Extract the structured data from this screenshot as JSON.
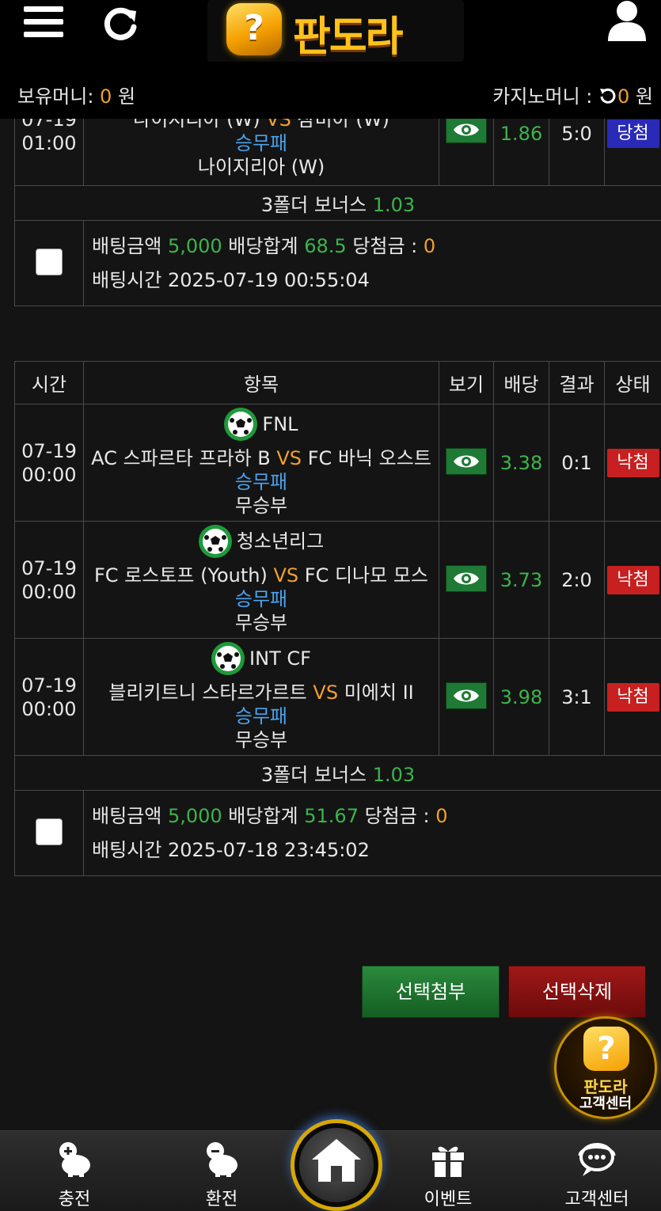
{
  "header": {
    "logo_text": "판도라",
    "logo_badge": "?",
    "money_label": "보유머니: ",
    "money_value": "0",
    "money_unit": " 원",
    "casino_label": "카지노머니 : ",
    "casino_value": "0",
    "casino_unit": " 원"
  },
  "table_headers": [
    "시간",
    "항목",
    "보기",
    "배당",
    "결과",
    "상태"
  ],
  "vs_text": "VS",
  "group1": {
    "row": {
      "time_line1": "07-19",
      "time_line2": "01:00",
      "match_home": "나이지리아 (W)",
      "match_away": "잠비아 (W)",
      "market": "승무패",
      "pick": "나이지리아 (W)",
      "odds": "1.86",
      "result": "5:0",
      "state": "당첨"
    },
    "bonus_label": "3폴더 보너스 ",
    "bonus_value": "1.03",
    "bet_amount_label": "배팅금액 ",
    "bet_amount": "5,000",
    "odds_total_label": " 배당합계 ",
    "odds_total": "68.5",
    "win_label": " 당첨금 : ",
    "win_amount": "0",
    "bet_time_label": "배팅시간 ",
    "bet_time": "2025-07-19 00:55:04"
  },
  "group2": {
    "rows": [
      {
        "time_line1": "07-19",
        "time_line2": "00:00",
        "league": "FNL",
        "match_home": "AC 스파르타 프라하 B",
        "match_away": "FC 바닉 오스트",
        "market": "승무패",
        "pick": "무승부",
        "odds": "3.38",
        "result": "0:1",
        "state": "낙첨"
      },
      {
        "time_line1": "07-19",
        "time_line2": "00:00",
        "league": "청소년리그",
        "match_home": "FC 로스토프 (Youth)",
        "match_away": "FC 디나모 모스",
        "market": "승무패",
        "pick": "무승부",
        "odds": "3.73",
        "result": "2:0",
        "state": "낙첨"
      },
      {
        "time_line1": "07-19",
        "time_line2": "00:00",
        "league": "INT CF",
        "match_home": "블리키트니 스타르가르트",
        "match_away": "미에치 II",
        "market": "승무패",
        "pick": "무승부",
        "odds": "3.98",
        "result": "3:1",
        "state": "낙첨"
      }
    ],
    "bonus_label": "3폴더 보너스 ",
    "bonus_value": "1.03",
    "bet_amount_label": "배팅금액 ",
    "bet_amount": "5,000",
    "odds_total_label": " 배당합계 ",
    "odds_total": "51.67",
    "win_label": " 당첨금 : ",
    "win_amount": "0",
    "bet_time_label": "배팅시간 ",
    "bet_time": "2025-07-18 23:45:02"
  },
  "actions": {
    "attach_label": "선택첨부",
    "delete_label": "선택삭제"
  },
  "cs_float": {
    "line1": "판도라",
    "line2": "고객센터"
  },
  "bottom_nav": {
    "charge": "충전",
    "exchange": "환전",
    "event": "이벤트",
    "support": "고객센터"
  },
  "colors": {
    "accent_orange": "#f0a030",
    "odds_green": "#3cb44b",
    "market_blue": "#4aa3f0",
    "lose_red": "#c82020",
    "win_blue": "#2a2ab8"
  }
}
